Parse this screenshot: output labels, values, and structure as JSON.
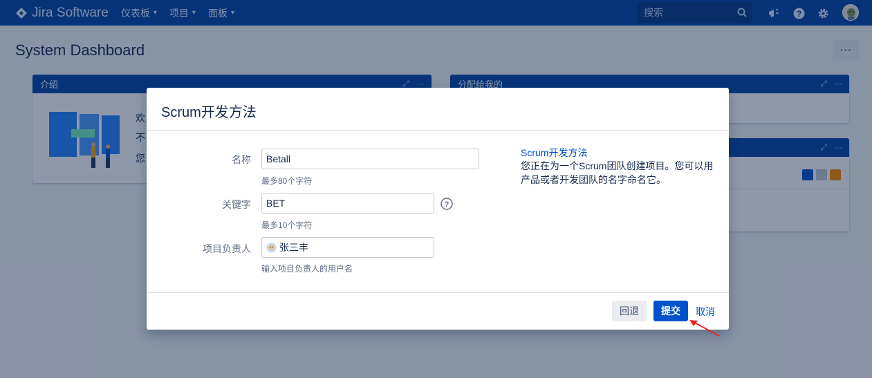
{
  "nav": {
    "brand": "Jira Software",
    "items": [
      {
        "label": "仪表板"
      },
      {
        "label": "项目"
      },
      {
        "label": "面板"
      }
    ],
    "search_placeholder": "搜索",
    "icons": [
      "megaphone-icon",
      "help-icon",
      "gear-icon",
      "avatar"
    ]
  },
  "page": {
    "title": "System Dashboard",
    "more": "···"
  },
  "gadgets": {
    "intro": {
      "title": "介绍",
      "lines": [
        "欢",
        "不",
        "您"
      ]
    },
    "assigned": {
      "title": "分配给我的"
    }
  },
  "dialog": {
    "title": "Scrum开发方法",
    "fields": {
      "name": {
        "label": "名称",
        "value": "Betall",
        "hint": "最多80个字符"
      },
      "key": {
        "label": "关键字",
        "value": "BET",
        "hint": "最多10个字符"
      },
      "lead": {
        "label": "项目负责人",
        "value": "张三丰",
        "hint": "输入项目负责人的用户名"
      }
    },
    "side": {
      "link": "Scrum开发方法",
      "description": "您正在为一个Scrum团队创建项目。您可以用产品或者开发团队的名字命名它。"
    },
    "buttons": {
      "back": "回退",
      "submit": "提交",
      "cancel": "取消"
    }
  },
  "colors": {
    "nav_bg": "#0747a6",
    "primary": "#0052cc",
    "overlay": "rgba(9,30,66,0.46)",
    "arrow": "#e5262a"
  }
}
